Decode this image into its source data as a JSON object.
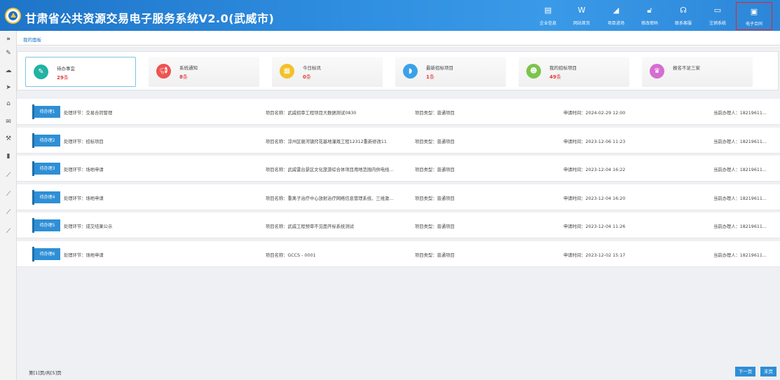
{
  "app": {
    "title": "甘肃省公共资源交易电子服务系统V2.0(武威市)"
  },
  "header_nav": [
    {
      "id": "enterprise",
      "label": "企业信息",
      "icon": "document-icon",
      "glyph": "▤"
    },
    {
      "id": "website",
      "label": "网站首页",
      "icon": "w-letter-icon",
      "glyph": "W"
    },
    {
      "id": "project",
      "label": "项目进场",
      "icon": "leaf-icon",
      "glyph": "◢"
    },
    {
      "id": "password",
      "label": "修改密码",
      "icon": "lock-icon",
      "glyph": "🔓︎"
    },
    {
      "id": "support",
      "label": "联系客服",
      "icon": "headset-icon",
      "glyph": "☊"
    },
    {
      "id": "logout",
      "label": "注销系统",
      "icon": "monitor-icon",
      "glyph": "▭"
    },
    {
      "id": "contract",
      "label": "电子合同",
      "icon": "contract-card-icon",
      "glyph": "▣",
      "active": true
    }
  ],
  "rail_icons": [
    "double-chevron-icon",
    "edit-icon",
    "cloud-icon",
    "send-icon",
    "shield-icon",
    "chat-icon",
    "gavel-icon",
    "book-icon",
    "chart-icon",
    "chart-icon",
    "chart-icon",
    "chart-icon"
  ],
  "breadcrumb": "我的面板",
  "cards": [
    {
      "title": "待办事宜",
      "count": "29",
      "unit": "条",
      "color": "#22b3a3",
      "glyph": "✎",
      "icon": "edit-icon"
    },
    {
      "title": "系统通知",
      "count": "8",
      "unit": "条",
      "color": "#ef5350",
      "glyph": "📢︎",
      "icon": "megaphone-icon"
    },
    {
      "title": "今日标讯",
      "count": "0",
      "unit": "条",
      "color": "#f3c12b",
      "glyph": "▦",
      "icon": "calendar-icon"
    },
    {
      "title": "最新招标项目",
      "count": "1",
      "unit": "条",
      "color": "#3ba2e8",
      "glyph": "◗",
      "icon": "flag-icon"
    },
    {
      "title": "我的招标项目",
      "count": "49",
      "unit": "条",
      "color": "#7cc44c",
      "glyph": "☻",
      "icon": "user-icon"
    },
    {
      "title": "报名不足三家",
      "count": "",
      "unit": "",
      "color": "#d56ed1",
      "glyph": "♛",
      "icon": "group-icon"
    }
  ],
  "tasks": [
    {
      "tag": "待办理1",
      "stage": "处理环节：交易合同管理",
      "project": "项目名称：武威招审工程项目大数据测试0830",
      "type": "项目类型：普通项目",
      "time": "申请时间：2024-02-29 12:00",
      "handler": "当前办理人：18219611..."
    },
    {
      "tag": "待办理2",
      "stage": "处理环节：招标项目",
      "project": "项目名称：凉州区谢河镇窍花基地灌溉工程12312重新修改11",
      "type": "项目类型：普通项目",
      "time": "申请时间：2023-12-06 11:23",
      "handler": "当前办理人：18219611..."
    },
    {
      "tag": "待办理3",
      "stage": "处理环节：场地申请",
      "project": "项目名称：武威雷台景区文化旅游综合体项目用地范围内供电线...",
      "type": "项目类型：普通项目",
      "time": "申请时间：2023-12-04 16:22",
      "handler": "当前办理人：18219611..."
    },
    {
      "tag": "待办理4",
      "stage": "处理环节：场地申请",
      "project": "项目名称：重离子治疗中心放射治疗网络信息管理系统、三维激...",
      "type": "项目类型：普通项目",
      "time": "申请时间：2023-12-04 16:20",
      "handler": "当前办理人：18219611..."
    },
    {
      "tag": "待办理5",
      "stage": "处理环节：成交结果公示",
      "project": "项目名称：武威工程预审不见面开标系统测试",
      "type": "项目类型：普通项目",
      "time": "申请时间：2023-12-04 11:26",
      "handler": "当前办理人：18219611..."
    },
    {
      "tag": "待办理6",
      "stage": "处理环节：场地申请",
      "project": "项目名称：GCCS - 0001",
      "type": "项目类型：普通项目",
      "time": "申请时间：2023-12-02 15:17",
      "handler": "当前办理人：18219611..."
    }
  ],
  "pager": {
    "info": "第[1]页/共[5]页",
    "next": "下一页",
    "last": "末页"
  }
}
